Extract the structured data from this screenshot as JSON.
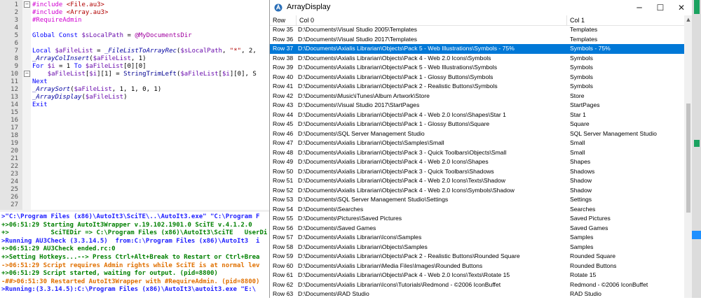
{
  "editor": {
    "line_numbers": [
      "1",
      "2",
      "3",
      "4",
      "5",
      "6",
      "7",
      "8",
      "9",
      "10",
      "11",
      "12",
      "13",
      "14",
      "15",
      "16",
      "17",
      "18",
      "19",
      "20",
      "21",
      "22",
      "23",
      "24",
      "25",
      "26",
      "27"
    ],
    "lines": [
      {
        "parts": [
          [
            "dir",
            "#include "
          ],
          [
            "str",
            "<File.au3>"
          ]
        ]
      },
      {
        "parts": [
          [
            "dir",
            "#include "
          ],
          [
            "str",
            "<Array.au3>"
          ]
        ]
      },
      {
        "parts": [
          [
            "dir",
            "#RequireAdmin"
          ]
        ]
      },
      {
        "parts": []
      },
      {
        "parts": [
          [
            "kw",
            "Global Const "
          ],
          [
            "var",
            "$sLocalPath"
          ],
          [
            "txt",
            " = "
          ],
          [
            "mac",
            "@MyDocumentsDir"
          ]
        ]
      },
      {
        "parts": []
      },
      {
        "parts": [
          [
            "kw",
            "Local "
          ],
          [
            "var",
            "$aFileList"
          ],
          [
            "txt",
            " = "
          ],
          [
            "fn",
            "_FileListToArrayRec"
          ],
          [
            "txt",
            "("
          ],
          [
            "var",
            "$sLocalPath"
          ],
          [
            "txt",
            ", "
          ],
          [
            "str",
            "\"*\""
          ],
          [
            "txt",
            ", 2, "
          ]
        ]
      },
      {
        "parts": [
          [
            "fn",
            "_ArrayColInsert"
          ],
          [
            "txt",
            "("
          ],
          [
            "var",
            "$aFileList"
          ],
          [
            "txt",
            ", 1)"
          ]
        ]
      },
      {
        "parts": [
          [
            "kw",
            "For "
          ],
          [
            "var",
            "$i"
          ],
          [
            "txt",
            " = 1 "
          ],
          [
            "kw",
            "To "
          ],
          [
            "var",
            "$aFileList"
          ],
          [
            "txt",
            "[0][0]"
          ]
        ]
      },
      {
        "parts": [
          [
            "txt",
            "    "
          ],
          [
            "var",
            "$aFileList"
          ],
          [
            "txt",
            "["
          ],
          [
            "var",
            "$i"
          ],
          [
            "txt",
            "][1] = "
          ],
          [
            "bi",
            "StringTrimLeft"
          ],
          [
            "txt",
            "("
          ],
          [
            "var",
            "$aFileList"
          ],
          [
            "txt",
            "["
          ],
          [
            "var",
            "$i"
          ],
          [
            "txt",
            "][0], S"
          ]
        ]
      },
      {
        "parts": [
          [
            "kw",
            "Next"
          ]
        ]
      },
      {
        "parts": [
          [
            "fn",
            "_ArraySort"
          ],
          [
            "txt",
            "("
          ],
          [
            "var",
            "$aFileList"
          ],
          [
            "txt",
            ", 1, 1, 0, 1)"
          ]
        ]
      },
      {
        "parts": [
          [
            "fn",
            "_ArrayDisplay"
          ],
          [
            "txt",
            "("
          ],
          [
            "var",
            "$aFileList"
          ],
          [
            "txt",
            ")"
          ]
        ]
      },
      {
        "parts": [
          [
            "kw",
            "Exit"
          ]
        ]
      }
    ]
  },
  "console": {
    "lines": [
      {
        "color": "#2020ff",
        "text": ">\"C:\\Program Files (x86)\\AutoIt3\\SciTE\\..\\AutoIt3.exe\" \"C:\\Program F"
      },
      {
        "color": "#008000",
        "text": "+>06:51:29 Starting AutoIt3Wrapper v.19.102.1901.0 SciTE v.4.1.2.0"
      },
      {
        "color": "#008000",
        "text": "+>           SciTEDir => C:\\Program Files (x86)\\AutoIt3\\SciTE   UserDi"
      },
      {
        "color": "#2020ff",
        "text": ">Running AU3Check (3.3.14.5)  from:C:\\Program Files (x86)\\AutoIt3  i"
      },
      {
        "color": "#008000",
        "text": "+>06:51:29 AU3Check ended.rc:0"
      },
      {
        "color": "#008000",
        "text": "+>Setting Hotkeys...--> Press Ctrl+Alt+Break to Restart or Ctrl+Brea"
      },
      {
        "color": "#e07000",
        "text": "->06:51:29 Script requires Admin rights while SciTE is at normal lev"
      },
      {
        "color": "#008000",
        "text": "+>06:51:29 Script started, waiting for output. (pid=8800)"
      },
      {
        "color": "#e07000",
        "text": "-##>06:51:30 Restarted AutoIt3Wrapper with #RequireAdmin. (pid=8800)"
      },
      {
        "color": "#2020ff",
        "text": ">Running:(3.3.14.5):C:\\Program Files (x86)\\AutoIt3\\autoit3.exe \"E:\\"
      }
    ]
  },
  "window": {
    "title": "ArrayDisplay",
    "minimize_glyph": "─",
    "maximize_glyph": "☐",
    "close_glyph": "✕",
    "columns": [
      "Row",
      "Col 0",
      "Col 1"
    ],
    "selected_row": "Row 37",
    "rows": [
      [
        "Row 35",
        "D:\\Documents\\Visual Studio 2005\\Templates",
        "Templates"
      ],
      [
        "Row 36",
        "D:\\Documents\\Visual Studio 2017\\Templates",
        "Templates"
      ],
      [
        "Row 37",
        "D:\\Documents\\Axialis Librarian\\Objects\\Pack 5 - Web Illustrations\\Symbols - 75%",
        "Symbols - 75%"
      ],
      [
        "Row 38",
        "D:\\Documents\\Axialis Librarian\\Objects\\Pack 4 - Web 2.0 Icons\\Symbols",
        "Symbols"
      ],
      [
        "Row 39",
        "D:\\Documents\\Axialis Librarian\\Objects\\Pack 5 - Web Illustrations\\Symbols",
        "Symbols"
      ],
      [
        "Row 40",
        "D:\\Documents\\Axialis Librarian\\Objects\\Pack 1 - Glossy Buttons\\Symbols",
        "Symbols"
      ],
      [
        "Row 41",
        "D:\\Documents\\Axialis Librarian\\Objects\\Pack 2 - Realistic Buttons\\Symbols",
        "Symbols"
      ],
      [
        "Row 42",
        "D:\\Documents\\Music\\iTunes\\Album Artwork\\Store",
        "Store"
      ],
      [
        "Row 43",
        "D:\\Documents\\Visual Studio 2017\\StartPages",
        "StartPages"
      ],
      [
        "Row 44",
        "D:\\Documents\\Axialis Librarian\\Objects\\Pack 4 - Web 2.0 Icons\\Shapes\\Star 1",
        "Star 1"
      ],
      [
        "Row 45",
        "D:\\Documents\\Axialis Librarian\\Objects\\Pack 1 - Glossy Buttons\\Square",
        "Square"
      ],
      [
        "Row 46",
        "D:\\Documents\\SQL Server Management Studio",
        "SQL Server Management Studio"
      ],
      [
        "Row 47",
        "D:\\Documents\\Axialis Librarian\\Objects\\Samples\\Small",
        "Small"
      ],
      [
        "Row 48",
        "D:\\Documents\\Axialis Librarian\\Objects\\Pack 3 - Quick Toolbars\\Objects\\Small",
        "Small"
      ],
      [
        "Row 49",
        "D:\\Documents\\Axialis Librarian\\Objects\\Pack 4 - Web 2.0 Icons\\Shapes",
        "Shapes"
      ],
      [
        "Row 50",
        "D:\\Documents\\Axialis Librarian\\Objects\\Pack 3 - Quick Toolbars\\Shadows",
        "Shadows"
      ],
      [
        "Row 51",
        "D:\\Documents\\Axialis Librarian\\Objects\\Pack 4 - Web 2.0 Icons\\Texts\\Shadow",
        "Shadow"
      ],
      [
        "Row 52",
        "D:\\Documents\\Axialis Librarian\\Objects\\Pack 4 - Web 2.0 Icons\\Symbols\\Shadow",
        "Shadow"
      ],
      [
        "Row 53",
        "D:\\Documents\\SQL Server Management Studio\\Settings",
        "Settings"
      ],
      [
        "Row 54",
        "D:\\Documents\\Searches",
        "Searches"
      ],
      [
        "Row 55",
        "D:\\Documents\\Pictures\\Saved Pictures",
        "Saved Pictures"
      ],
      [
        "Row 56",
        "D:\\Documents\\Saved Games",
        "Saved Games"
      ],
      [
        "Row 57",
        "D:\\Documents\\Axialis Librarian\\Icons\\Samples",
        "Samples"
      ],
      [
        "Row 58",
        "D:\\Documents\\Axialis Librarian\\Objects\\Samples",
        "Samples"
      ],
      [
        "Row 59",
        "D:\\Documents\\Axialis Librarian\\Objects\\Pack 2 - Realistic Buttons\\Rounded Square",
        "Rounded Square"
      ],
      [
        "Row 60",
        "D:\\Documents\\Axialis Librarian\\Media Files\\Images\\Rounded Buttons",
        "Rounded Buttons"
      ],
      [
        "Row 61",
        "D:\\Documents\\Axialis Librarian\\Objects\\Pack 4 - Web 2.0 Icons\\Texts\\Rotate 15",
        "Rotate 15"
      ],
      [
        "Row 62",
        "D:\\Documents\\Axialis Librarian\\Icons\\Tutorials\\Redmond - ©2006 IconBuffet",
        "Redmond - ©2006 IconBuffet"
      ],
      [
        "Row 63",
        "D:\\Documents\\RAD Studio",
        "RAD Studio"
      ]
    ]
  },
  "colors": {
    "selection": "#0078d7",
    "keyword": "#0000ff",
    "string": "#b00000",
    "directive": "#d000d0"
  }
}
